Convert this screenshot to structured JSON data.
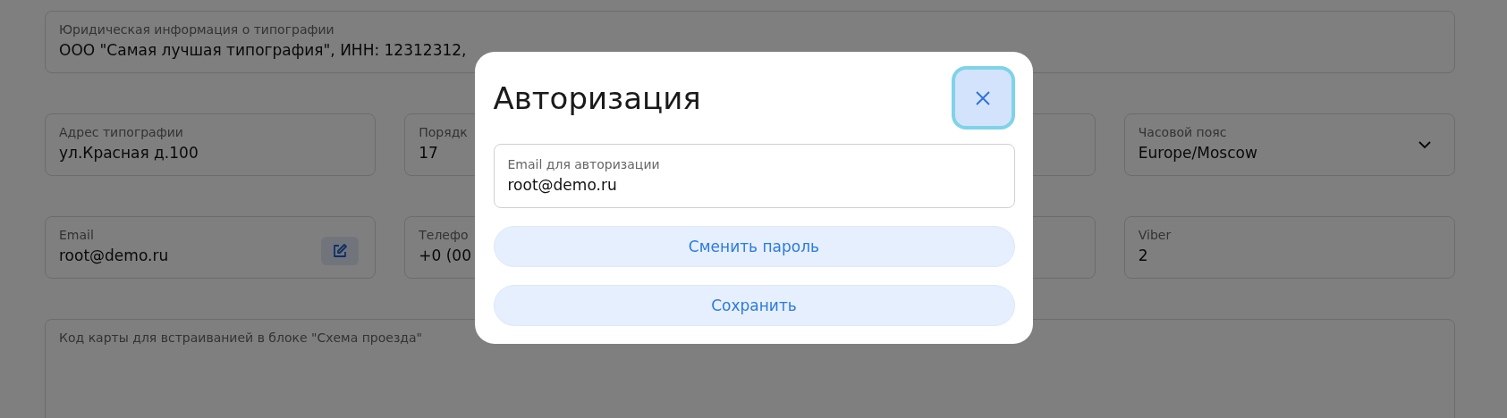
{
  "form": {
    "rows": [
      {
        "fields": [
          {
            "kind": "text",
            "label": "Юридическая информация о типографии",
            "value": "ООО \"Самая лучшая типография\", ИНН: 12312312,"
          }
        ]
      },
      {
        "fields": [
          {
            "kind": "text",
            "label": "Адрес типографии",
            "value": "ул.Красная д.100"
          },
          {
            "kind": "text",
            "label": "Порядк",
            "value": "17"
          },
          {
            "kind": "text"
          },
          {
            "kind": "select",
            "label": "Часовой пояс",
            "value": "Europe/Moscow"
          }
        ]
      },
      {
        "fields": [
          {
            "kind": "edit",
            "label": "Email",
            "value": "root@demo.ru"
          },
          {
            "kind": "text",
            "label": "Телефо",
            "value": "+0 (00"
          },
          {
            "kind": "text"
          },
          {
            "kind": "text",
            "label": "Viber",
            "value": "2"
          }
        ]
      },
      {
        "fields": [
          {
            "kind": "textarea",
            "label": "Код карты для встраиванией в блоке \"Схема проезда\""
          }
        ]
      }
    ]
  },
  "dialog": {
    "title": "Авторизация",
    "email": {
      "label": "Email для авторизации",
      "value": "root@demo.ru"
    },
    "buttons": [
      "Сменить пароль",
      "Сохранить"
    ]
  }
}
